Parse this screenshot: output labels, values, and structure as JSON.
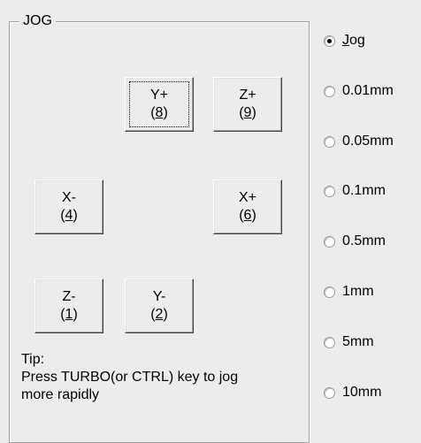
{
  "group": {
    "title": "JOG"
  },
  "buttons": [
    {
      "id": "y-plus",
      "line1": "Y+",
      "key": "8",
      "focused": true
    },
    {
      "id": "z-plus",
      "line1": "Z+",
      "key": "9",
      "focused": false
    },
    {
      "id": "x-minus",
      "line1": "X-",
      "key": "4",
      "focused": false
    },
    {
      "id": "x-plus",
      "line1": "X+",
      "key": "6",
      "focused": false
    },
    {
      "id": "z-minus",
      "line1": "Z-",
      "key": "1",
      "focused": false
    },
    {
      "id": "y-minus",
      "line1": "Y-",
      "key": "2",
      "focused": false
    }
  ],
  "tip": {
    "title": "Tip:",
    "line1": "Press TURBO(or CTRL) key to jog",
    "line2": "more rapidly"
  },
  "step_options": {
    "selected": "Jog",
    "items": [
      {
        "label": "Jog",
        "mnemonic": "J",
        "rest": "og"
      },
      {
        "label": "0.01mm"
      },
      {
        "label": "0.05mm"
      },
      {
        "label": "0.1mm"
      },
      {
        "label": "0.5mm"
      },
      {
        "label": "1mm"
      },
      {
        "label": "5mm"
      },
      {
        "label": "10mm"
      }
    ]
  },
  "colors": {
    "face": "#ececec",
    "frame": "#a0a0a0"
  }
}
